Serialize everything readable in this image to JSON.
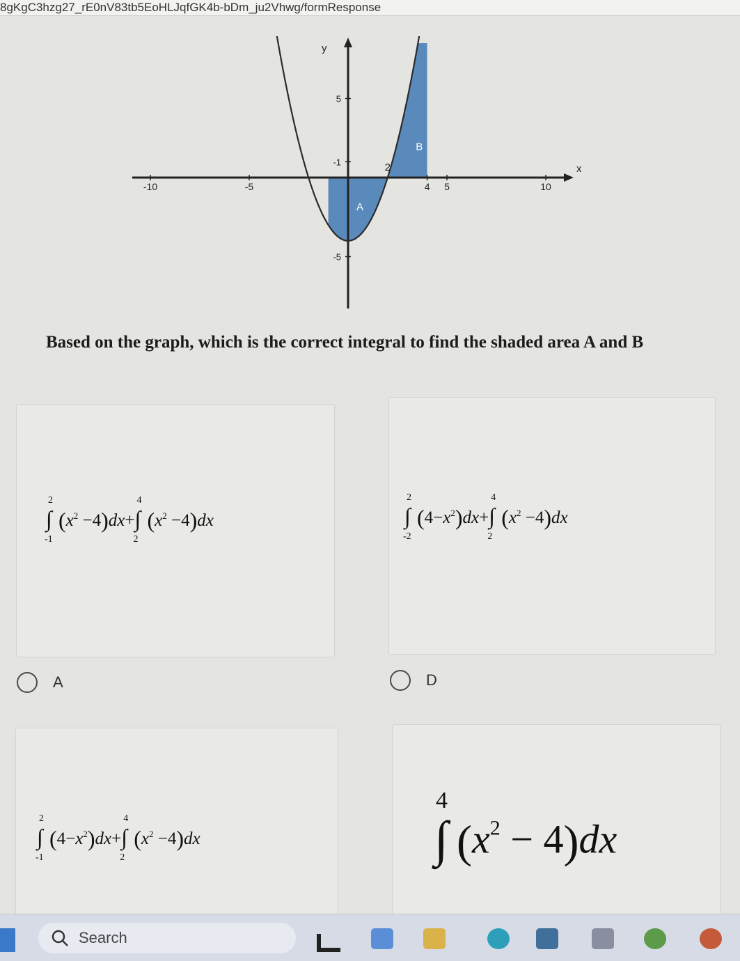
{
  "browser": {
    "url_text": "8gKgC3hzg27_rE0nV83tb5EoHLJqfGK4b-bDm_ju2Vhwg/formResponse"
  },
  "chart_data": {
    "type": "line",
    "title": "",
    "xlabel": "x",
    "ylabel": "y",
    "xlim": [
      -13.5,
      13.5
    ],
    "ylim": [
      -8.5,
      8.5
    ],
    "x_ticks": [
      -10,
      -5,
      4,
      5,
      10
    ],
    "x_tick_labels": [
      "-10",
      "-5",
      "4",
      "5",
      "10"
    ],
    "y_ticks": [
      5,
      1,
      -5
    ],
    "y_tick_labels": [
      "5",
      "-1",
      "-5"
    ],
    "annotations": [
      {
        "text": "2",
        "x": 2,
        "y": 0
      },
      {
        "text": "A",
        "x": 0.6,
        "y": -1.8
      },
      {
        "text": "B",
        "x": 3.6,
        "y": 2.0
      }
    ],
    "series": [
      {
        "function": "x^2 - 4",
        "x_from": -3.7,
        "x_to": 4.7
      }
    ],
    "shaded_regions": [
      {
        "label": "A",
        "x_from": -1,
        "x_to": 2
      },
      {
        "label": "B",
        "x_from": 2,
        "x_to": 4
      }
    ],
    "fill_color": "#4a7fb8",
    "curve_color": "#2b2b2b"
  },
  "question": "Based on the graph, which is the correct integral to find the shaded area A and B",
  "options": [
    {
      "letter": "A",
      "terms": [
        {
          "upper": "2",
          "lower": "-1",
          "a": "x",
          "b": "4",
          "order": "x-first"
        },
        {
          "upper": "4",
          "lower": "2",
          "a": "x",
          "b": "4",
          "order": "x-first"
        }
      ]
    },
    {
      "letter": "D",
      "terms": [
        {
          "upper": "2",
          "lower": "-2",
          "a": "4",
          "b": "x",
          "order": "const-first"
        },
        {
          "upper": "4",
          "lower": "2",
          "a": "x",
          "b": "4",
          "order": "x-first"
        }
      ]
    },
    {
      "letter": "",
      "terms": [
        {
          "upper": "2",
          "lower": "-1",
          "a": "4",
          "b": "x",
          "order": "const-first"
        },
        {
          "upper": "4",
          "lower": "2",
          "a": "x",
          "b": "4",
          "order": "x-first"
        }
      ]
    },
    {
      "letter": "",
      "terms": [
        {
          "upper": "4",
          "lower": "",
          "a": "x",
          "b": "4",
          "order": "x-first"
        }
      ]
    }
  ],
  "math": {
    "exp": "2",
    "minus": "−",
    "plus": "+",
    "dx": "dx"
  },
  "taskbar": {
    "search_label": "Search"
  }
}
